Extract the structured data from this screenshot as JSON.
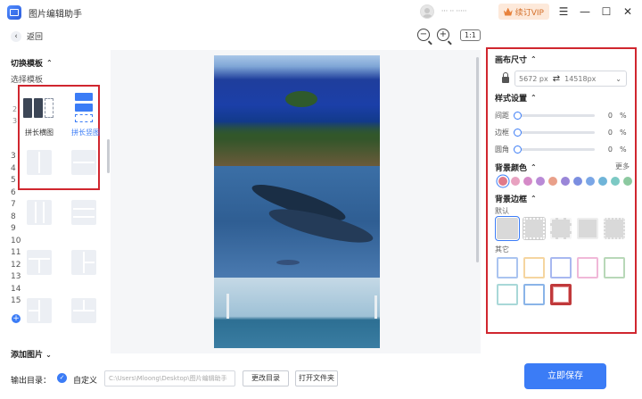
{
  "app": {
    "title": "图片编辑助手",
    "user_name": "··· ·· ·····"
  },
  "header": {
    "vip_label": "续订VIP",
    "back_label": "返回",
    "zoom_label": "1:1"
  },
  "left": {
    "switch_template_label": "切换模板",
    "select_template_label": "选择模板",
    "templates": [
      {
        "caption": "拼长横图"
      },
      {
        "caption": "拼长竖图"
      }
    ],
    "row_numbers": [
      "3",
      "4",
      "5",
      "6",
      "7",
      "8",
      "9",
      "10",
      "11",
      "12",
      "13",
      "14",
      "15"
    ],
    "add_image_label": "添加图片"
  },
  "right": {
    "canvas_size_label": "画布尺寸",
    "width": "5672",
    "height": "14518",
    "unit": "px",
    "style_label": "样式设置",
    "sliders": [
      {
        "label": "间距",
        "value": "0",
        "unit": "%"
      },
      {
        "label": "边框",
        "value": "0",
        "unit": "%"
      },
      {
        "label": "圆角",
        "value": "0",
        "unit": "%"
      }
    ],
    "bg_color_label": "背景颜色",
    "more_label": "更多",
    "colors": [
      "#e07a8a",
      "#e8a2c0",
      "#d58ac8",
      "#b98ad6",
      "#e9a08a",
      "#9a86d8",
      "#7b8ee0",
      "#7aa6e6",
      "#6fb4d8",
      "#7cc9c4",
      "#8cc9a0"
    ],
    "bg_border_label": "背景边框",
    "default_label": "默认",
    "other_label": "其它",
    "other_frames": [
      "#aac4f0",
      "#f5d5a0",
      "#a8b8f0",
      "#f0b8d8",
      "#b8d8b8",
      "#a8d8d8",
      "#8ab4e8",
      "#c0393b"
    ]
  },
  "bottom": {
    "output_label": "输出目录：",
    "custom_label": "自定义",
    "path": "C:\\Users\\Mloong\\Desktop\\图片编辑助手",
    "change_dir_label": "更改目录",
    "open_folder_label": "打开文件夹",
    "save_label": "立即保存"
  }
}
